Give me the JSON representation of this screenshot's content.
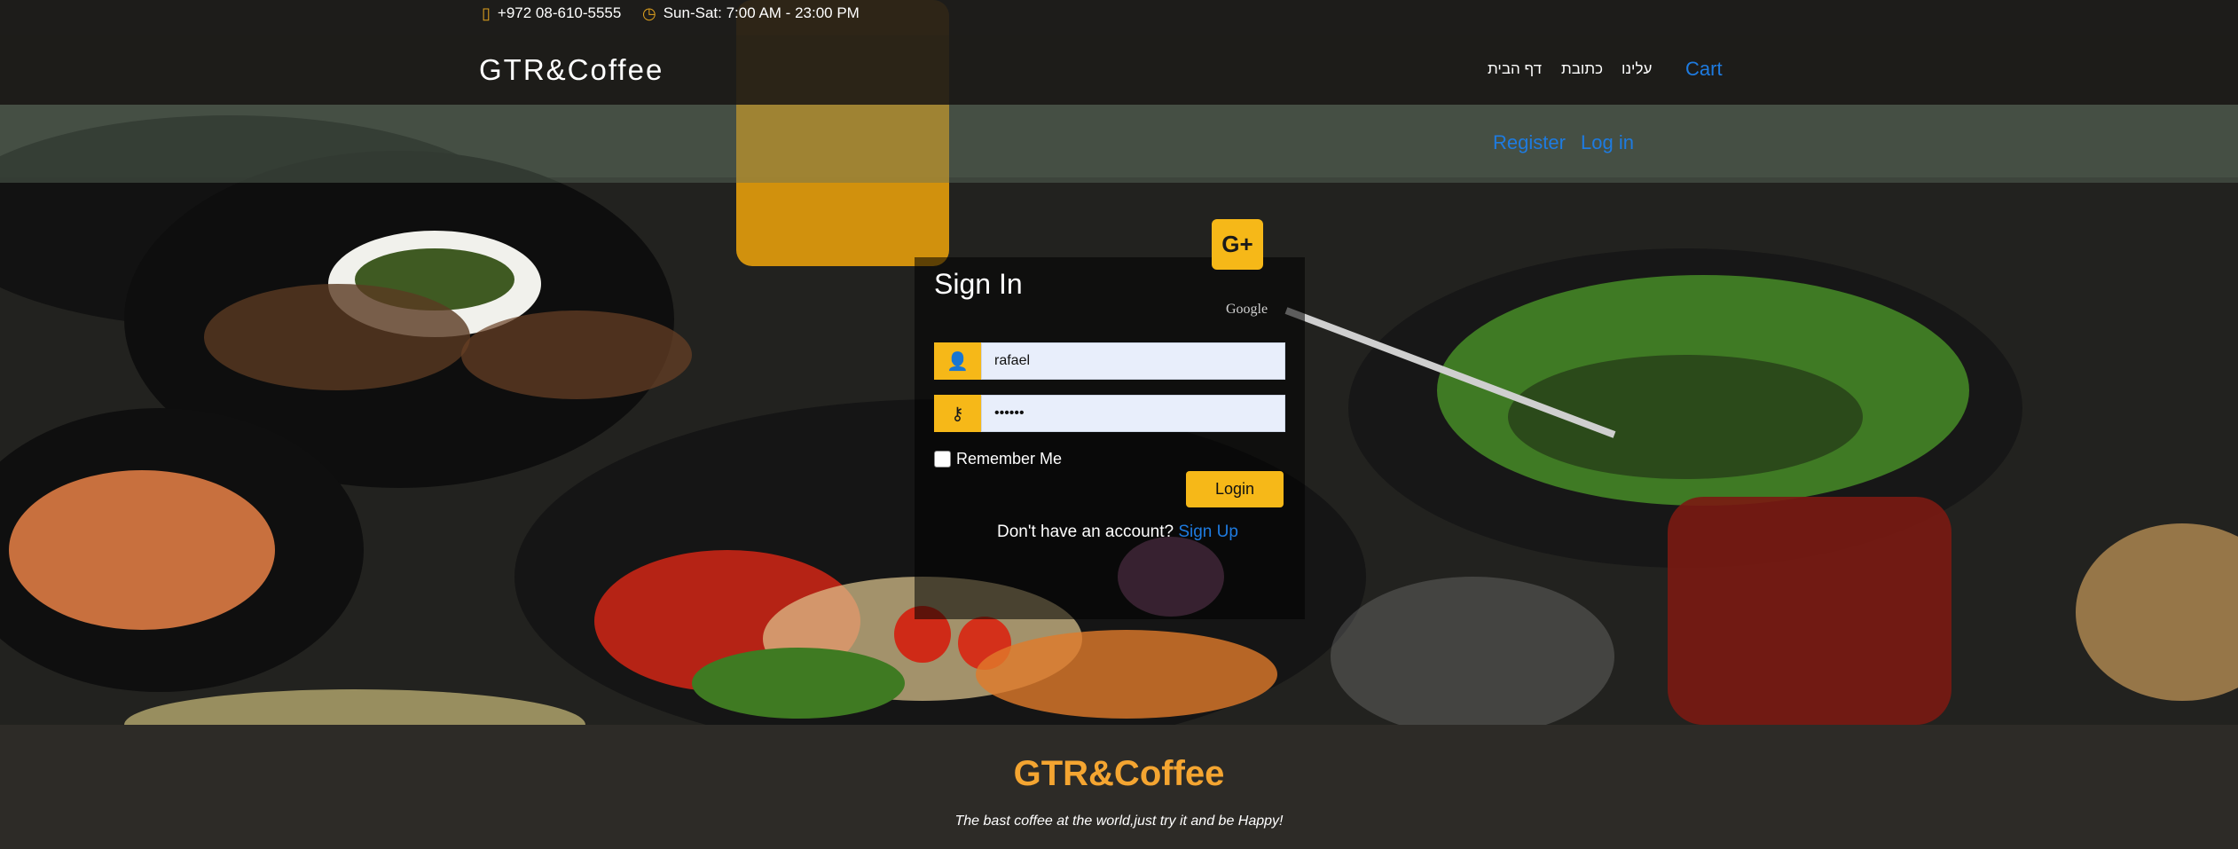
{
  "topbar": {
    "phone": "+972 08-610-5555",
    "phone_icon": "mobile-phone-icon",
    "hours": "Sun-Sat: 7:00 AM - 23:00 PM",
    "hours_icon": "clock-icon"
  },
  "navbar": {
    "brand": "GTR&Coffee",
    "links": [
      "דף הבית",
      "כתובת",
      "עלינו"
    ],
    "cart": "Cart"
  },
  "auth": {
    "register": "Register",
    "login": "Log in"
  },
  "signin": {
    "title": "Sign In",
    "google_button": "G+",
    "google_text": "Google",
    "username_value": "rafael",
    "user_icon": "user-icon",
    "password_value": "••••••",
    "key_icon": "key-icon",
    "remember_label": "Remember Me",
    "login_button": "Login",
    "no_account": "Don't have an account? ",
    "signup_link": "Sign Up"
  },
  "footer": {
    "title": "GTR&Coffee",
    "tagline": "The bast coffee at the world,just try it and be Happy!"
  },
  "colors": {
    "accent": "#f6b818",
    "link": "#1e7be0",
    "footer_title": "#f4a531"
  }
}
